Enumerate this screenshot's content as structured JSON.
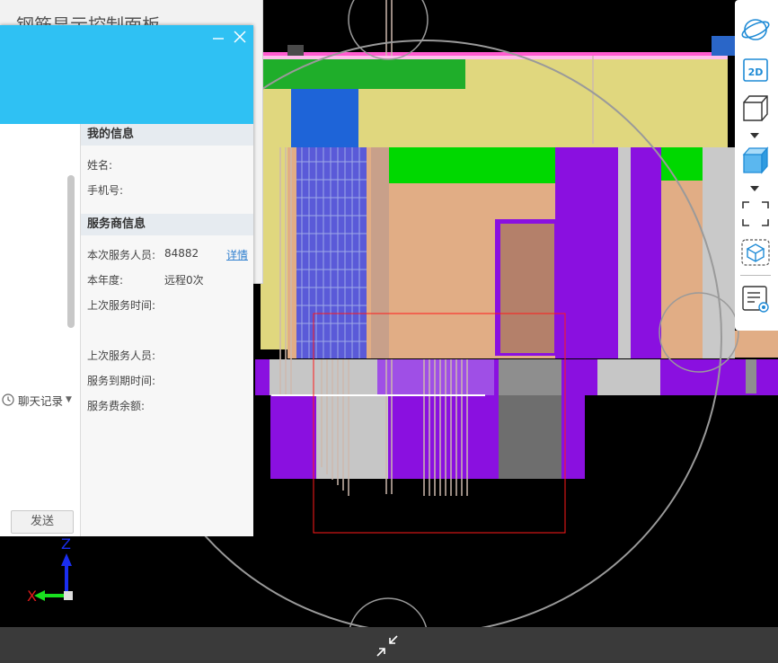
{
  "back_panel": {
    "title": "钢筋显示控制面板"
  },
  "chat": {
    "chat_log_label": "聊天记录",
    "send_label": "发送"
  },
  "info": {
    "my_info": {
      "heading": "我的信息",
      "name_label": "姓名:",
      "phone_label": "手机号:"
    },
    "provider": {
      "heading": "服务商信息",
      "staff_label": "本次服务人员:",
      "staff_value": "84882",
      "detail_link": "详情",
      "year_label": "本年度:",
      "year_value": "远程0次",
      "last_time_label": "上次服务时间:",
      "last_staff_label": "上次服务人员:",
      "expire_label": "服务到期时间:",
      "balance_label": "服务费余额:"
    }
  },
  "axis": {
    "x_label": "X",
    "z_label": "Z"
  },
  "toolbar": {
    "buttons": [
      "orbit-icon",
      "2d-view-icon",
      "3d-wire-cube-icon",
      "3d-solid-cube-icon",
      "fullscreen-icon",
      "view-cube-icon",
      "properties-icon"
    ],
    "two_d_label": "2D"
  },
  "colors": {
    "header": "#2fc1f3",
    "accent_link": "#2f7fcf",
    "toolbar_icon": "#1f8bd6"
  }
}
